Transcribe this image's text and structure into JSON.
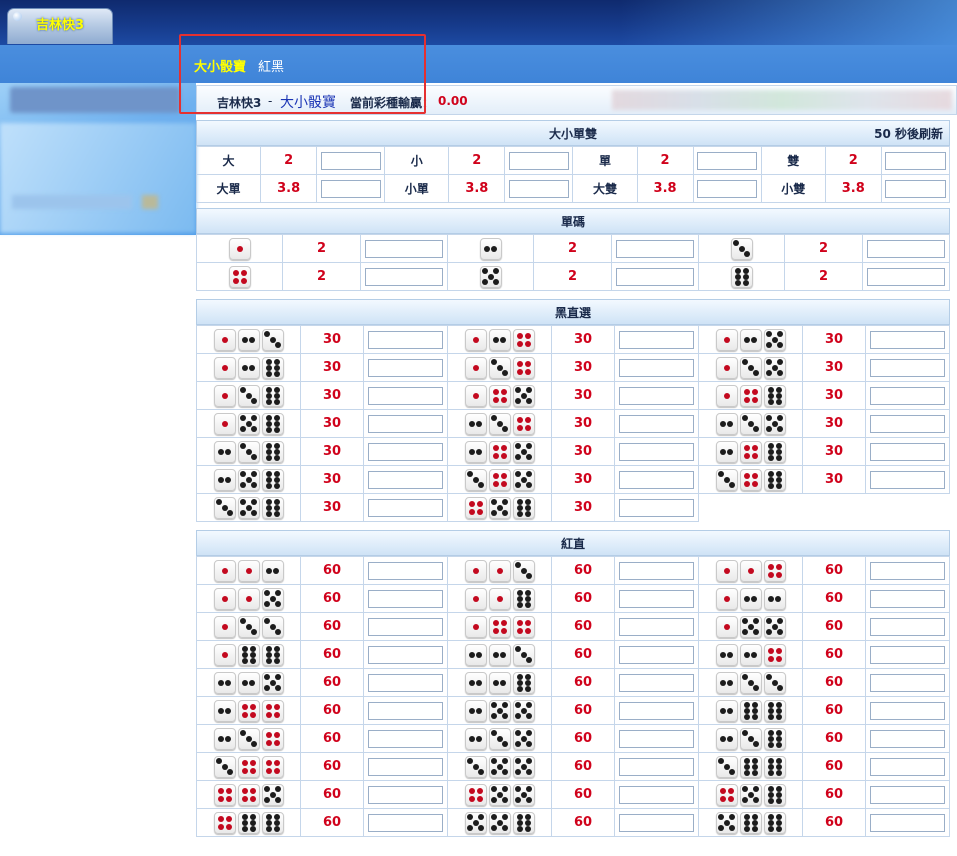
{
  "top": {
    "tab": "吉林快3"
  },
  "nav": {
    "a": "大小骰寶",
    "b": "紅黑"
  },
  "info": {
    "game": "吉林快3",
    "sep": "-",
    "sub": "大小骰寶",
    "label": "當前彩種輸贏：",
    "amount": "0.00"
  },
  "colors": {
    "accent_red": "#d0021b",
    "pip_red": "#c3091f",
    "pip_black": "#1c1c1c",
    "nav_yellow": "#ffff00"
  },
  "dsds": {
    "title": "大小單雙",
    "countdown": "50 秒後刷新",
    "rows": [
      [
        {
          "n": "大",
          "o": "2"
        },
        {
          "n": "小",
          "o": "2"
        },
        {
          "n": "單",
          "o": "2"
        },
        {
          "n": "雙",
          "o": "2"
        }
      ],
      [
        {
          "n": "大單",
          "o": "3.8"
        },
        {
          "n": "小單",
          "o": "3.8"
        },
        {
          "n": "大雙",
          "o": "3.8"
        },
        {
          "n": "小雙",
          "o": "3.8"
        }
      ]
    ]
  },
  "single": {
    "title": "單碼",
    "rows": [
      [
        {
          "d": [
            1
          ],
          "o": "2"
        },
        {
          "d": [
            2
          ],
          "o": "2"
        },
        {
          "d": [
            3
          ],
          "o": "2"
        }
      ],
      [
        {
          "d": [
            4
          ],
          "o": "2"
        },
        {
          "d": [
            5
          ],
          "o": "2"
        },
        {
          "d": [
            6
          ],
          "o": "2"
        }
      ]
    ]
  },
  "black": {
    "title": "黑直選",
    "rows": [
      [
        {
          "d": [
            1,
            2,
            3
          ],
          "o": "30"
        },
        {
          "d": [
            1,
            2,
            4
          ],
          "o": "30"
        },
        {
          "d": [
            1,
            2,
            5
          ],
          "o": "30"
        }
      ],
      [
        {
          "d": [
            1,
            2,
            6
          ],
          "o": "30"
        },
        {
          "d": [
            1,
            3,
            4
          ],
          "o": "30"
        },
        {
          "d": [
            1,
            3,
            5
          ],
          "o": "30"
        }
      ],
      [
        {
          "d": [
            1,
            3,
            6
          ],
          "o": "30"
        },
        {
          "d": [
            1,
            4,
            5
          ],
          "o": "30"
        },
        {
          "d": [
            1,
            4,
            6
          ],
          "o": "30"
        }
      ],
      [
        {
          "d": [
            1,
            5,
            6
          ],
          "o": "30"
        },
        {
          "d": [
            2,
            3,
            4
          ],
          "o": "30"
        },
        {
          "d": [
            2,
            3,
            5
          ],
          "o": "30"
        }
      ],
      [
        {
          "d": [
            2,
            3,
            6
          ],
          "o": "30"
        },
        {
          "d": [
            2,
            4,
            5
          ],
          "o": "30"
        },
        {
          "d": [
            2,
            4,
            6
          ],
          "o": "30"
        }
      ],
      [
        {
          "d": [
            2,
            5,
            6
          ],
          "o": "30"
        },
        {
          "d": [
            3,
            4,
            5
          ],
          "o": "30"
        },
        {
          "d": [
            3,
            4,
            6
          ],
          "o": "30"
        }
      ],
      [
        {
          "d": [
            3,
            5,
            6
          ],
          "o": "30"
        },
        {
          "d": [
            4,
            5,
            6
          ],
          "o": "30"
        }
      ]
    ]
  },
  "red": {
    "title": "紅直",
    "rows": [
      [
        {
          "d": [
            1,
            1,
            2
          ],
          "o": "60"
        },
        {
          "d": [
            1,
            1,
            3
          ],
          "o": "60"
        },
        {
          "d": [
            1,
            1,
            4
          ],
          "o": "60"
        }
      ],
      [
        {
          "d": [
            1,
            1,
            5
          ],
          "o": "60"
        },
        {
          "d": [
            1,
            1,
            6
          ],
          "o": "60"
        },
        {
          "d": [
            1,
            2,
            2
          ],
          "o": "60"
        }
      ],
      [
        {
          "d": [
            1,
            3,
            3
          ],
          "o": "60"
        },
        {
          "d": [
            1,
            4,
            4
          ],
          "o": "60"
        },
        {
          "d": [
            1,
            5,
            5
          ],
          "o": "60"
        }
      ],
      [
        {
          "d": [
            1,
            6,
            6
          ],
          "o": "60"
        },
        {
          "d": [
            2,
            2,
            3
          ],
          "o": "60"
        },
        {
          "d": [
            2,
            2,
            4
          ],
          "o": "60"
        }
      ],
      [
        {
          "d": [
            2,
            2,
            5
          ],
          "o": "60"
        },
        {
          "d": [
            2,
            2,
            6
          ],
          "o": "60"
        },
        {
          "d": [
            2,
            3,
            3
          ],
          "o": "60"
        }
      ],
      [
        {
          "d": [
            2,
            4,
            4
          ],
          "o": "60"
        },
        {
          "d": [
            2,
            5,
            5
          ],
          "o": "60"
        },
        {
          "d": [
            2,
            6,
            6
          ],
          "o": "60"
        }
      ],
      [
        {
          "d": [
            2,
            3,
            4
          ],
          "o": "60"
        },
        {
          "d": [
            2,
            3,
            5
          ],
          "o": "60"
        },
        {
          "d": [
            2,
            3,
            6
          ],
          "o": "60"
        }
      ],
      [
        {
          "d": [
            3,
            4,
            4
          ],
          "o": "60"
        },
        {
          "d": [
            3,
            5,
            5
          ],
          "o": "60"
        },
        {
          "d": [
            3,
            6,
            6
          ],
          "o": "60"
        }
      ],
      [
        {
          "d": [
            4,
            4,
            5
          ],
          "o": "60"
        },
        {
          "d": [
            4,
            5,
            5
          ],
          "o": "60"
        },
        {
          "d": [
            4,
            5,
            6
          ],
          "o": "60"
        }
      ],
      [
        {
          "d": [
            4,
            6,
            6
          ],
          "o": "60"
        },
        {
          "d": [
            5,
            5,
            6
          ],
          "o": "60"
        },
        {
          "d": [
            5,
            6,
            6
          ],
          "o": "60"
        }
      ]
    ]
  }
}
